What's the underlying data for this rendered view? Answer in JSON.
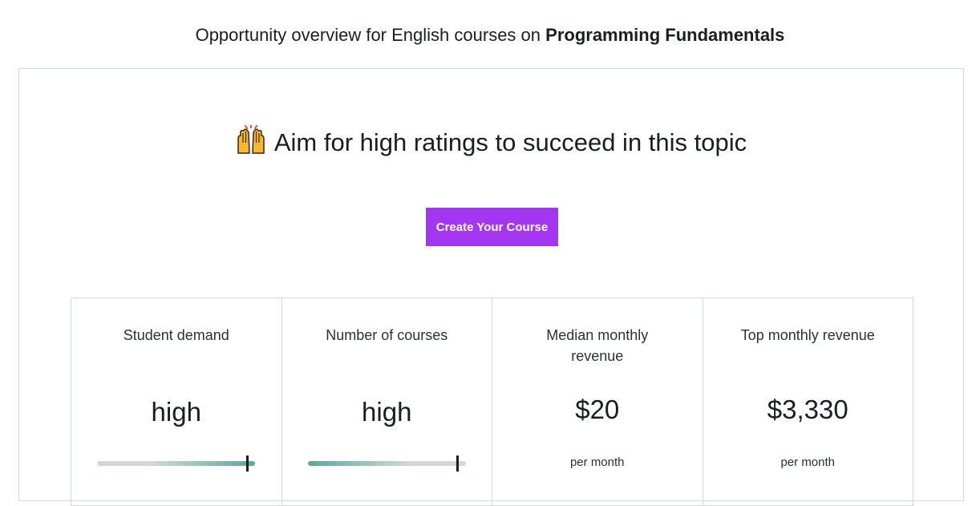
{
  "header": {
    "prefix": "Opportunity overview for English courses on",
    "topic": "Programming Fundamentals"
  },
  "headline": {
    "emoji": "raising-hands-icon",
    "text": "Aim for high ratings to succeed in this topic"
  },
  "cta": {
    "label": "Create Your Course",
    "color": "#a435f0"
  },
  "metrics": [
    {
      "label": "Student demand",
      "value": "high",
      "gauge_level": 0.95
    },
    {
      "label": "Number of courses",
      "value": "high",
      "gauge_level": 0.95
    },
    {
      "label": "Median monthly revenue",
      "value": "$20",
      "unit": "per month"
    },
    {
      "label": "Top monthly revenue",
      "value": "$3,330",
      "unit": "per month"
    }
  ],
  "colors": {
    "gauge_fill": "#5aa899",
    "gauge_track": "#d1d7dc"
  }
}
